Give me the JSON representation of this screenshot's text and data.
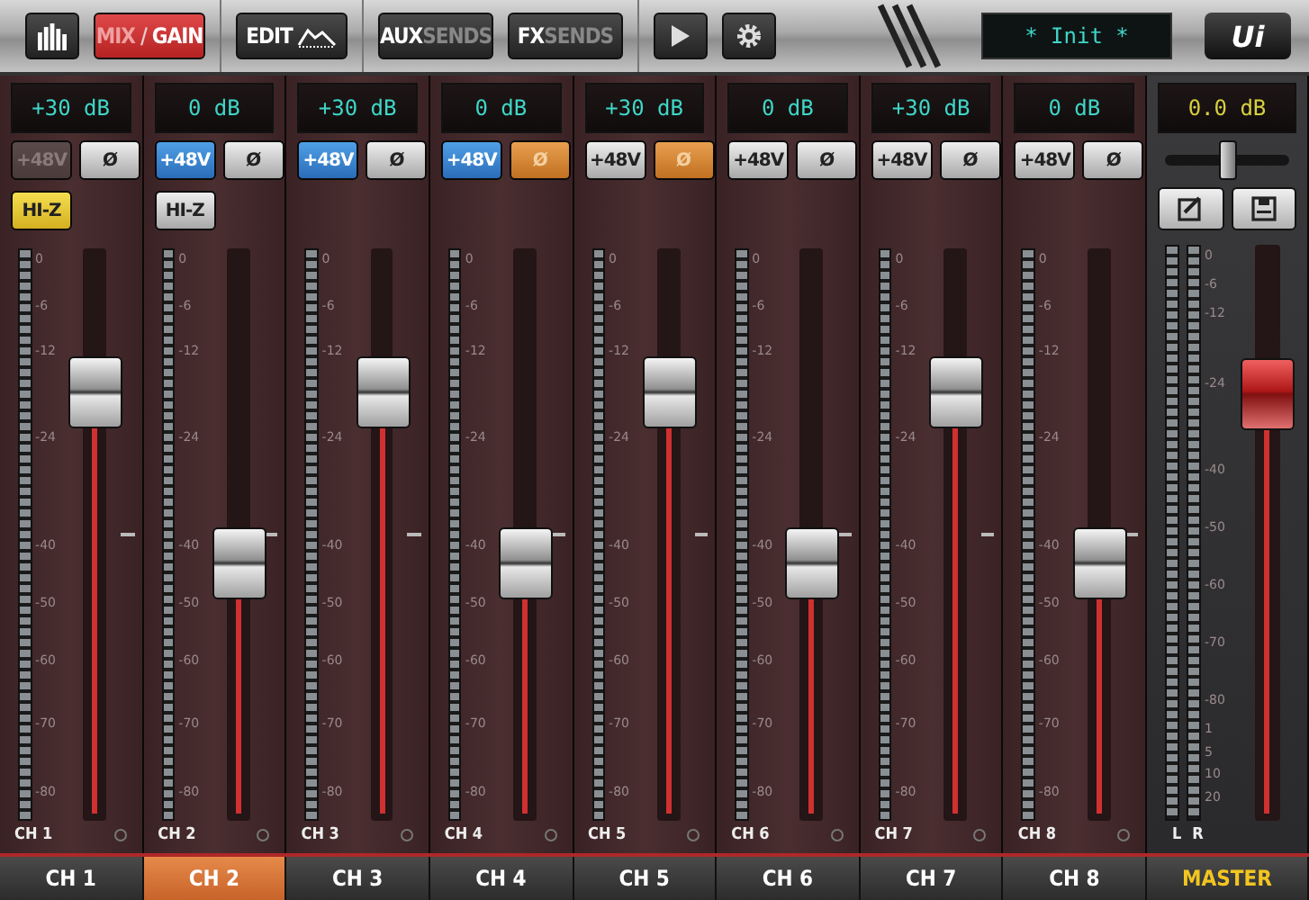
{
  "toolbar": {
    "mix_gain": {
      "primary": "MIX",
      "separator": "/",
      "secondary": "GAIN",
      "selected": true
    },
    "edit": {
      "label": "EDIT"
    },
    "aux_sends": {
      "primary": "AUX",
      "secondary": "SENDS"
    },
    "fx_sends": {
      "primary": "FX",
      "secondary": "SENDS"
    },
    "snapshot": {
      "text": "* Init *"
    },
    "logo": "Ui"
  },
  "channels": [
    {
      "gain": "+30 dB",
      "phantom": {
        "label": "+48V",
        "on": false,
        "disabled": true
      },
      "phase": {
        "label": "Ø",
        "on": false
      },
      "hiz": {
        "label": "HI-Z",
        "on": true
      },
      "scale": [
        "0",
        "-6",
        "-12",
        "-24",
        "-40",
        "-50",
        "-60",
        "-70",
        "-80"
      ],
      "level": 0.75,
      "name": "CH 1"
    },
    {
      "gain": "0 dB",
      "phantom": {
        "label": "+48V",
        "on": true,
        "disabled": false
      },
      "phase": {
        "label": "Ø",
        "on": false
      },
      "hiz": {
        "label": "HI-Z",
        "on": false
      },
      "scale": [
        "0",
        "-6",
        "-12",
        "-24",
        "-40",
        "-50",
        "-60",
        "-70",
        "-80"
      ],
      "level": 0.45,
      "name": "CH 2"
    },
    {
      "gain": "+30 dB",
      "phantom": {
        "label": "+48V",
        "on": true,
        "disabled": false
      },
      "phase": {
        "label": "Ø",
        "on": false
      },
      "scale": [
        "0",
        "-6",
        "-12",
        "-24",
        "-40",
        "-50",
        "-60",
        "-70",
        "-80"
      ],
      "level": 0.75,
      "name": "CH 3"
    },
    {
      "gain": "0 dB",
      "phantom": {
        "label": "+48V",
        "on": true,
        "disabled": false
      },
      "phase": {
        "label": "Ø",
        "on": true
      },
      "scale": [
        "0",
        "-6",
        "-12",
        "-24",
        "-40",
        "-50",
        "-60",
        "-70",
        "-80"
      ],
      "level": 0.45,
      "name": "CH 4"
    },
    {
      "gain": "+30 dB",
      "phantom": {
        "label": "+48V",
        "on": false,
        "disabled": false
      },
      "phase": {
        "label": "Ø",
        "on": true
      },
      "scale": [
        "0",
        "-6",
        "-12",
        "-24",
        "-40",
        "-50",
        "-60",
        "-70",
        "-80"
      ],
      "level": 0.75,
      "name": "CH 5"
    },
    {
      "gain": "0 dB",
      "phantom": {
        "label": "+48V",
        "on": false,
        "disabled": false
      },
      "phase": {
        "label": "Ø",
        "on": false
      },
      "scale": [
        "0",
        "-6",
        "-12",
        "-24",
        "-40",
        "-50",
        "-60",
        "-70",
        "-80"
      ],
      "level": 0.45,
      "name": "CH 6"
    },
    {
      "gain": "+30 dB",
      "phantom": {
        "label": "+48V",
        "on": false,
        "disabled": false
      },
      "phase": {
        "label": "Ø",
        "on": false
      },
      "scale": [
        "0",
        "-6",
        "-12",
        "-24",
        "-40",
        "-50",
        "-60",
        "-70",
        "-80"
      ],
      "level": 0.75,
      "name": "CH 7"
    },
    {
      "gain": "0 dB",
      "phantom": {
        "label": "+48V",
        "on": false,
        "disabled": false
      },
      "phase": {
        "label": "Ø",
        "on": false
      },
      "scale": [
        "0",
        "-6",
        "-12",
        "-24",
        "-40",
        "-50",
        "-60",
        "-70",
        "-80"
      ],
      "level": 0.45,
      "name": "CH 8"
    }
  ],
  "master": {
    "display": "0.0 dB",
    "pan": {
      "level": 0.5
    },
    "level": 0.74,
    "meter_labels": [
      "L",
      "R"
    ],
    "scale": [
      "0",
      "-6",
      "-12",
      "-24",
      "-40",
      "-50",
      "-60",
      "-70",
      "-80",
      "1",
      "5",
      "10",
      "20"
    ]
  },
  "tabs": [
    {
      "label": "CH 1",
      "kind": "channel",
      "selected": false
    },
    {
      "label": "CH 2",
      "kind": "channel",
      "selected": true
    },
    {
      "label": "CH 3",
      "kind": "channel",
      "selected": false
    },
    {
      "label": "CH 4",
      "kind": "channel",
      "selected": false
    },
    {
      "label": "CH 5",
      "kind": "channel",
      "selected": false
    },
    {
      "label": "CH 6",
      "kind": "channel",
      "selected": false
    },
    {
      "label": "CH 7",
      "kind": "channel",
      "selected": false
    },
    {
      "label": "CH 8",
      "kind": "channel",
      "selected": false
    },
    {
      "label": "MASTER",
      "kind": "master",
      "selected": false
    }
  ]
}
